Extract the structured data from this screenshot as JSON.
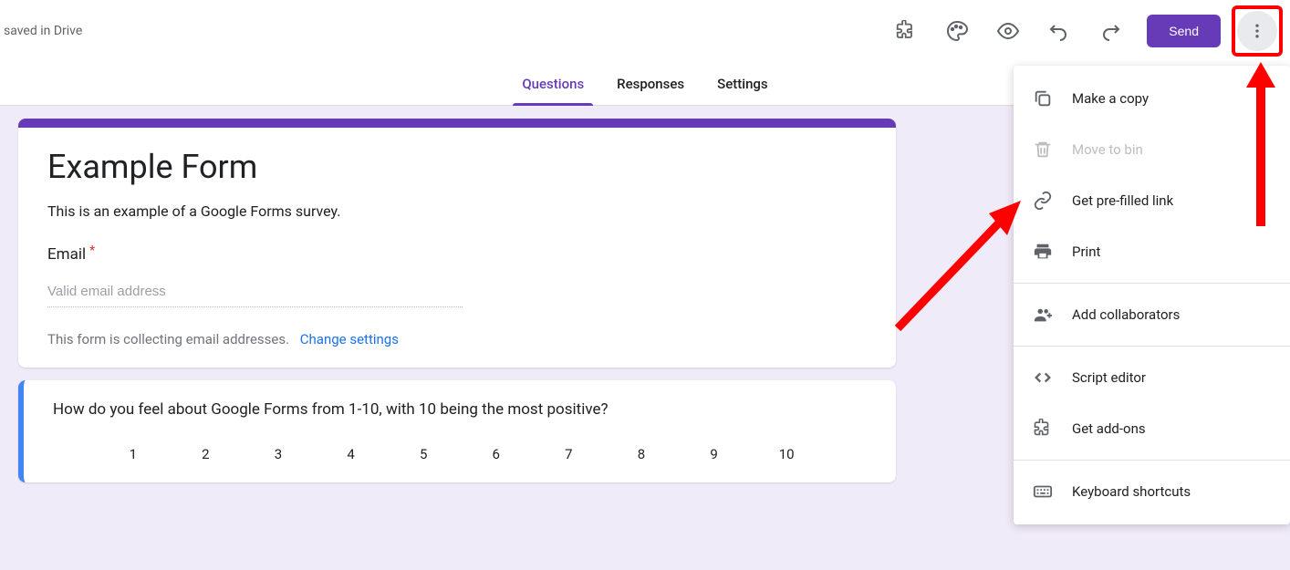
{
  "header": {
    "save_status": "saved in Drive",
    "send_label": "Send"
  },
  "tabs": [
    {
      "label": "Questions",
      "active": true
    },
    {
      "label": "Responses",
      "active": false
    },
    {
      "label": "Settings",
      "active": false
    }
  ],
  "form": {
    "title": "Example Form",
    "description": "This is an example of a Google Forms survey.",
    "email_label": "Email",
    "email_placeholder": "Valid email address",
    "collect_text": "This form is collecting email addresses.",
    "change_settings_label": "Change settings"
  },
  "question": {
    "text": "How do you feel about Google Forms from 1-10, with 10 being the most positive?",
    "scale": [
      "1",
      "2",
      "3",
      "4",
      "5",
      "6",
      "7",
      "8",
      "9",
      "10"
    ]
  },
  "menu": {
    "items": [
      {
        "icon": "copy-icon",
        "label": "Make a copy",
        "disabled": false
      },
      {
        "icon": "trash-icon",
        "label": "Move to bin",
        "disabled": true
      },
      {
        "icon": "link-icon",
        "label": "Get pre-filled link",
        "disabled": false
      },
      {
        "icon": "print-icon",
        "label": "Print",
        "disabled": false
      },
      {
        "divider": true
      },
      {
        "icon": "add-collab-icon",
        "label": "Add collaborators",
        "disabled": false
      },
      {
        "divider": true
      },
      {
        "icon": "script-icon",
        "label": "Script editor",
        "disabled": false
      },
      {
        "icon": "addon-icon",
        "label": "Get add-ons",
        "disabled": false
      },
      {
        "divider": true
      },
      {
        "icon": "keyboard-icon",
        "label": "Keyboard shortcuts",
        "disabled": false
      }
    ]
  },
  "colors": {
    "accent": "#673ab7",
    "highlight": "#ff0000",
    "link": "#1a73e8"
  }
}
